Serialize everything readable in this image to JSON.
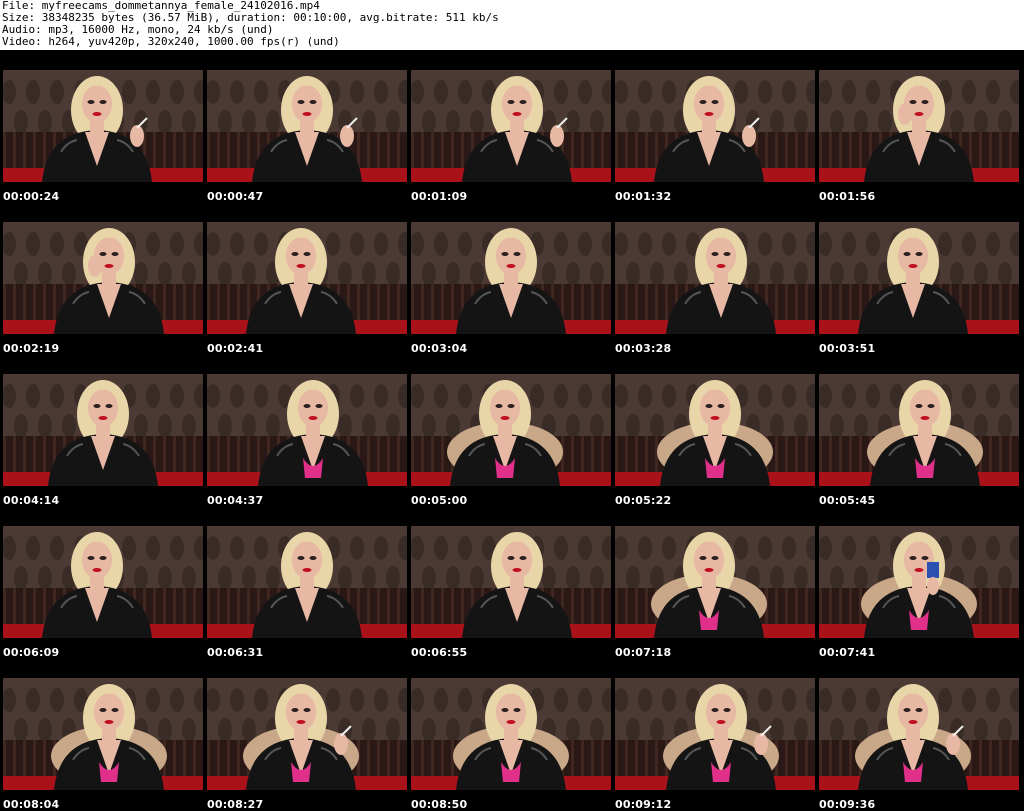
{
  "header": {
    "file_line": "File: myfreecams_dommetannya_female_24102016.mp4",
    "size_line": "Size: 38348235 bytes (36.57 MiB), duration: 00:10:00, avg.bitrate: 511 kb/s",
    "audio_line": "Audio: mp3, 16000 Hz, mono, 24 kb/s (und)",
    "video_line": "Video: h264, yuv420p, 320x240, 1000.00 fps(r) (und)"
  },
  "colors": {
    "sheet_background": "#000000",
    "timestamp_text": "#ffffff",
    "wallpaper": "#4a3a33",
    "curtain": "#2a1816",
    "floor": "#a81218",
    "jacket": "#141414",
    "hair": "#e8d6a8",
    "skin": "#e7b8a4",
    "top_pink": "#e0308a",
    "chair": "#c8a888"
  },
  "thumbnails": [
    {
      "time": "00:00:24",
      "variant": "smoke"
    },
    {
      "time": "00:00:47",
      "variant": "smoke"
    },
    {
      "time": "00:01:09",
      "variant": "smoke"
    },
    {
      "time": "00:01:32",
      "variant": "smoke"
    },
    {
      "time": "00:01:56",
      "variant": "hand"
    },
    {
      "time": "00:02:19",
      "variant": "hand"
    },
    {
      "time": "00:02:41",
      "variant": "plain"
    },
    {
      "time": "00:03:04",
      "variant": "plain"
    },
    {
      "time": "00:03:28",
      "variant": "plain"
    },
    {
      "time": "00:03:51",
      "variant": "plain"
    },
    {
      "time": "00:04:14",
      "variant": "plain"
    },
    {
      "time": "00:04:37",
      "variant": "pink"
    },
    {
      "time": "00:05:00",
      "variant": "chair"
    },
    {
      "time": "00:05:22",
      "variant": "chair"
    },
    {
      "time": "00:05:45",
      "variant": "chair"
    },
    {
      "time": "00:06:09",
      "variant": "plain"
    },
    {
      "time": "00:06:31",
      "variant": "plain"
    },
    {
      "time": "00:06:55",
      "variant": "plain"
    },
    {
      "time": "00:07:18",
      "variant": "chair"
    },
    {
      "time": "00:07:41",
      "variant": "cup"
    },
    {
      "time": "00:08:04",
      "variant": "chair"
    },
    {
      "time": "00:08:27",
      "variant": "chair-smoke"
    },
    {
      "time": "00:08:50",
      "variant": "chair"
    },
    {
      "time": "00:09:12",
      "variant": "chair-smoke"
    },
    {
      "time": "00:09:36",
      "variant": "chair-smoke"
    }
  ]
}
